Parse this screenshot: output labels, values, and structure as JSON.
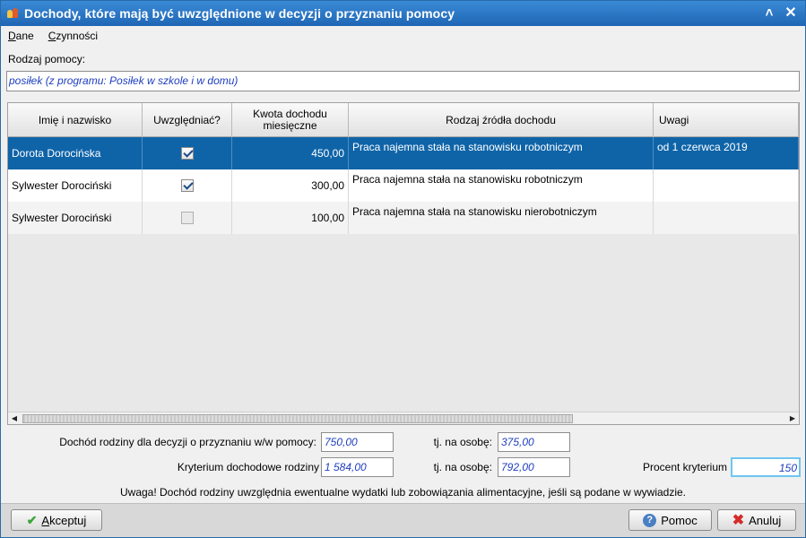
{
  "window": {
    "title": "Dochody, które mają być uwzględnione w decyzji o przyznaniu pomocy"
  },
  "menu": {
    "items": [
      {
        "label": "Dane",
        "underline": "D",
        "rest": "ane"
      },
      {
        "label": "Czynności",
        "underline": "C",
        "rest": "zynności"
      }
    ]
  },
  "rodzaj": {
    "label": "Rodzaj pomocy:",
    "value": "posiłek (z programu: Posiłek w szkole i w domu)"
  },
  "grid": {
    "columns": [
      "Imię i nazwisko",
      "Uwzględniać?",
      "Kwota dochodu miesięczne",
      "Rodzaj źródła dochodu",
      "Uwagi"
    ],
    "column_marker": "E",
    "rows": [
      {
        "name": "Dorota Dorocińska",
        "include": true,
        "amount": "450,00",
        "source": "Praca najemna stała na stanowisku robotniczym",
        "notes": "od 1 czerwca 2019",
        "selected": true
      },
      {
        "name": "Sylwester Dorociński",
        "include": true,
        "amount": "300,00",
        "source": "Praca najemna stała na stanowisku robotniczym",
        "notes": "",
        "selected": false
      },
      {
        "name": "Sylwester Dorociński",
        "include": false,
        "amount": "100,00",
        "source": "Praca najemna stała na stanowisku nierobotniczym",
        "notes": "",
        "selected": false
      }
    ]
  },
  "summary": {
    "income_label": "Dochód rodziny dla decyzji o przyznaniu w/w pomocy:",
    "income_value": "750,00",
    "per_person_label": "tj. na osobę:",
    "income_per_person": "375,00",
    "criterion_label": "Kryterium dochodowe rodziny",
    "criterion_value": "1 584,00",
    "criterion_per_person": "792,00",
    "percent_label": "Procent kryterium",
    "percent_value": "150"
  },
  "note": "Uwaga! Dochód rodziny uwzględnia ewentualne wydatki lub zobowiązania alimentacyjne, jeśli są podane w wywiadzie.",
  "buttons": {
    "ok": {
      "underline": "A",
      "rest": "kceptuj"
    },
    "help": {
      "label": "Pomoc"
    },
    "cancel": {
      "label": "Anuluj"
    }
  },
  "colors": {
    "titlebar": "#1f66b5",
    "selection": "#0f64a8",
    "value_text": "#1f3fbf",
    "focus_border": "#6ec6f0"
  }
}
